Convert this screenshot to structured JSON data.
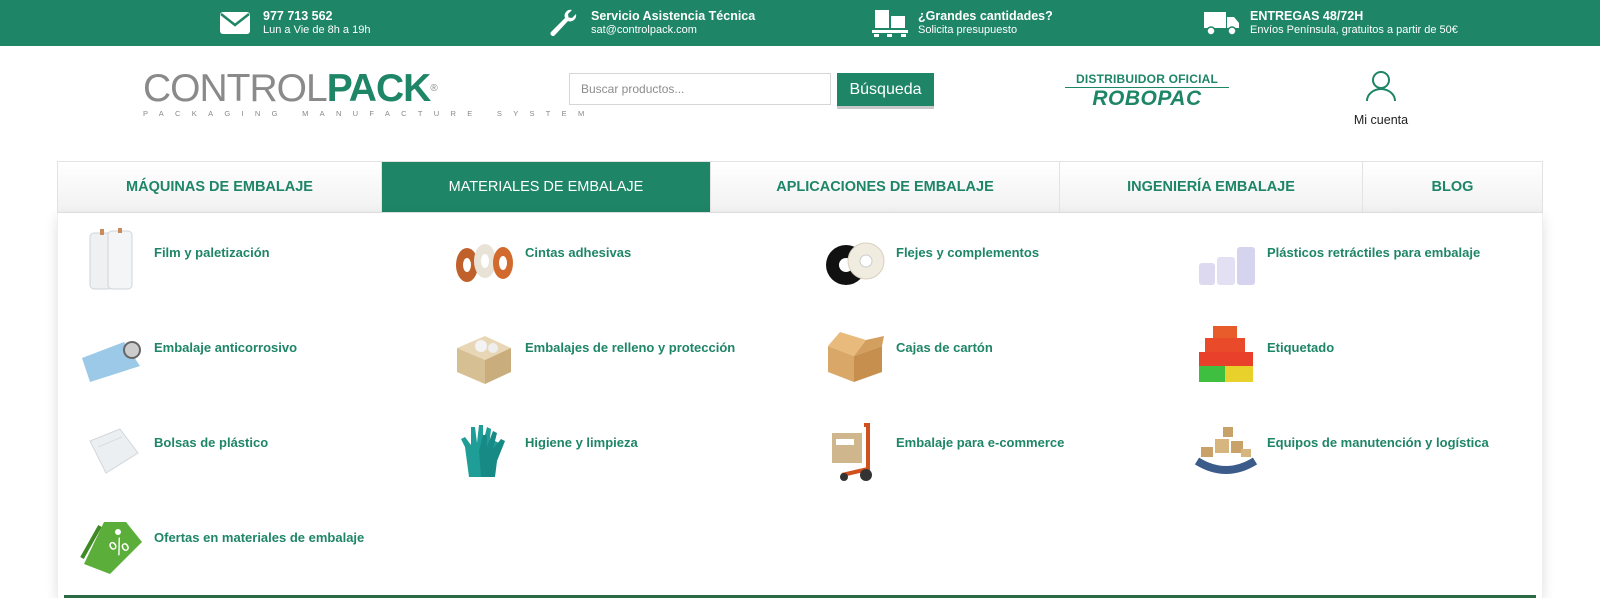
{
  "topbar": {
    "items": [
      {
        "icon": "envelope-icon",
        "title": "977 713 562",
        "subtitle": "Lun a Vie de 8h a 19h"
      },
      {
        "icon": "wrench-icon",
        "title": "Servicio Asistencia Técnica",
        "subtitle": "sat@controlpack.com"
      },
      {
        "icon": "pallet-icon",
        "title": "¿Grandes cantidades?",
        "subtitle": "Solicita presupuesto"
      },
      {
        "icon": "truck-icon",
        "title": "ENTREGAS 48/72H",
        "subtitle": "Envíos Península, gratuitos a partir de 50€"
      }
    ]
  },
  "header": {
    "logo": {
      "part1": "CONTROL",
      "part2": "PACK",
      "registered": "®",
      "tagline": "PACKAGING MANUFACTURE SYSTEM"
    },
    "search": {
      "placeholder": "Buscar productos...",
      "button_label": "Búsqueda"
    },
    "distributor": {
      "line1": "DISTRIBUIDOR OFICIAL",
      "line2": "ROBOPAC"
    },
    "account": {
      "label": "Mi cuenta",
      "icon": "user-icon"
    }
  },
  "nav": {
    "items": [
      {
        "label": "MÁQUINAS DE EMBALAJE",
        "active": false
      },
      {
        "label": "MATERIALES DE EMBALAJE",
        "active": true
      },
      {
        "label": "APLICACIONES DE EMBALAJE",
        "active": false
      },
      {
        "label": "INGENIERÍA EMBALAJE",
        "active": false
      },
      {
        "label": "BLOG",
        "active": false
      }
    ]
  },
  "menu": {
    "categories": [
      {
        "label": "Film y paletización",
        "icon": "stretch-film-icon"
      },
      {
        "label": "Cintas adhesivas",
        "icon": "tape-rolls-icon"
      },
      {
        "label": "Flejes y complementos",
        "icon": "strapping-rolls-icon"
      },
      {
        "label": "Plásticos retráctiles para embalaje",
        "icon": "shrink-film-icon"
      },
      {
        "label": "Embalaje anticorrosivo",
        "icon": "anticorrosive-bag-icon"
      },
      {
        "label": "Embalajes de relleno y protección",
        "icon": "filler-box-icon"
      },
      {
        "label": "Cajas de cartón",
        "icon": "cardboard-box-icon"
      },
      {
        "label": "Etiquetado",
        "icon": "labels-icon"
      },
      {
        "label": "Bolsas de plástico",
        "icon": "plastic-bag-icon"
      },
      {
        "label": "Higiene y limpieza",
        "icon": "gloves-icon"
      },
      {
        "label": "Embalaje para e-commerce",
        "icon": "hand-truck-icon"
      },
      {
        "label": "Equipos de manutención y logística",
        "icon": "conveyor-icon"
      },
      {
        "label": "Ofertas en materiales de embalaje",
        "icon": "discount-tag-icon"
      }
    ]
  },
  "colors": {
    "brand": "#1e8566",
    "text": "#222222"
  }
}
